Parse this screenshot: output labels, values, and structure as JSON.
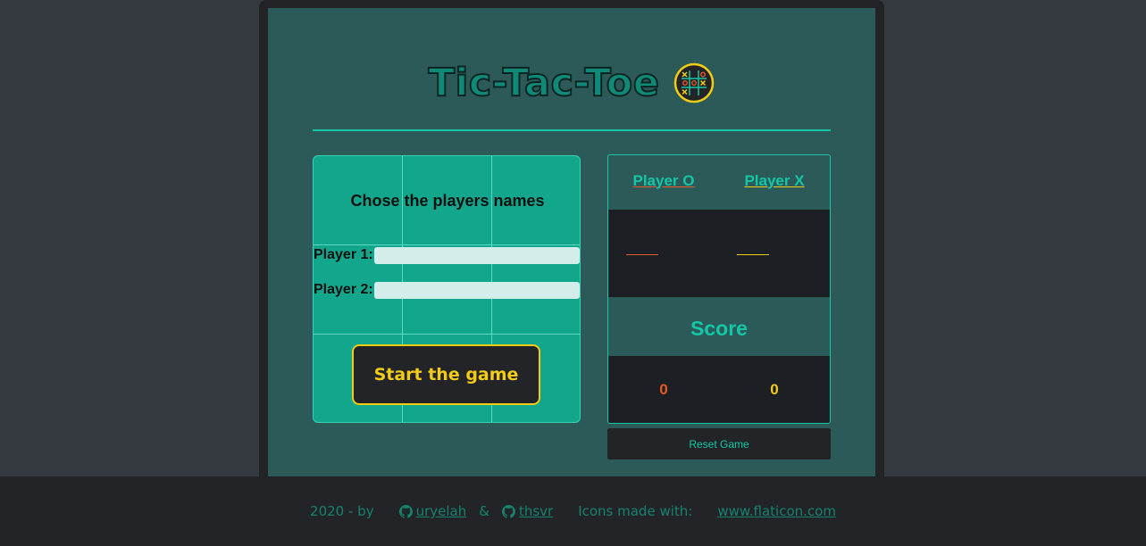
{
  "header": {
    "title": "Tic-Tac-Toe",
    "logo_icon": "tic-tac-toe-grid-icon"
  },
  "setup": {
    "heading": "Chose the players names",
    "player1_label": "Player 1:",
    "player1_value": "",
    "player2_label": "Player 2:",
    "player2_value": "",
    "start_button": "Start the game"
  },
  "scoreboard": {
    "player_o_label": "Player O",
    "player_x_label": "Player X",
    "player_o_name": "",
    "player_x_name": "",
    "score_title": "Score",
    "score_o": "0",
    "score_x": "0",
    "reset_button": "Reset Game"
  },
  "footer": {
    "credit_prefix": "2020 - by",
    "author1": "uryelah",
    "ampersand": "&",
    "author2": "thsvr",
    "icons_text": "Icons made with:",
    "icons_link": "www.flaticon.com"
  },
  "colors": {
    "panel_bg": "#2c5a58",
    "board_bg": "#12a78c",
    "accent": "#14c7a6",
    "player_o": "#e8582a",
    "player_x": "#f2cc17"
  }
}
